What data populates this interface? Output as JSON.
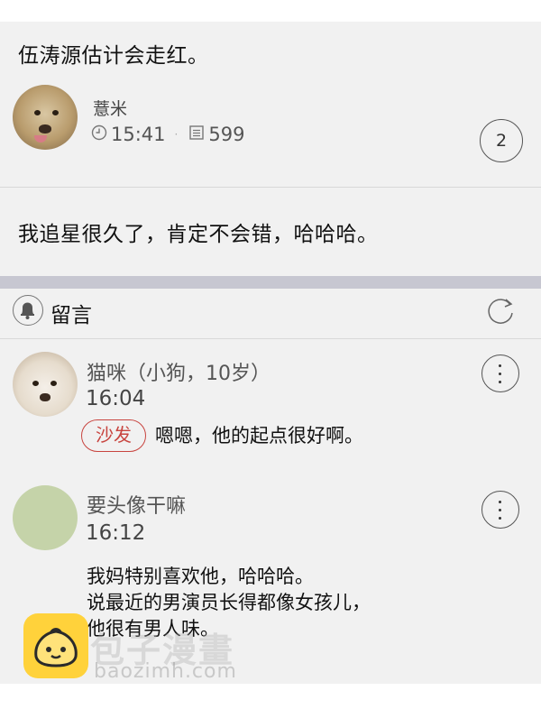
{
  "post": {
    "title": "伍涛源估计会走红。",
    "user": "薏米",
    "time": "15:41",
    "views": "599",
    "count": "2"
  },
  "reply": {
    "text": "我追星很久了，肯定不会错，哈哈哈。"
  },
  "comments_header": {
    "title": "留言"
  },
  "comments": [
    {
      "user": "猫咪（小狗，10岁）",
      "time": "16:04",
      "tag": "沙发",
      "text": "嗯嗯，他的起点很好啊。"
    },
    {
      "user": "要头像干嘛",
      "time": "16:12",
      "lines": [
        "我妈特别喜欢他，哈哈哈。",
        "说最近的男演员长得都像女孩儿，",
        "他很有男人味。"
      ]
    }
  ],
  "watermark": {
    "text": "包子漫畫",
    "url": "baozimh.com"
  }
}
